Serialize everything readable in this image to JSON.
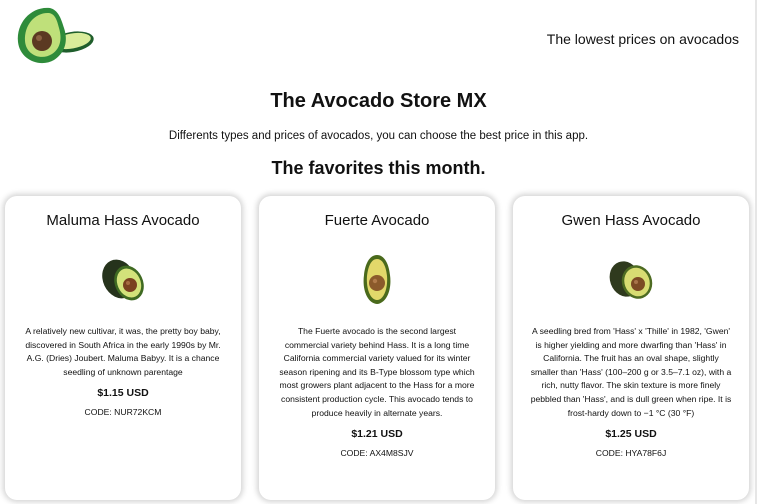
{
  "header": {
    "tagline": "The lowest prices on avocados"
  },
  "main": {
    "title": "The Avocado Store MX",
    "subtitle": "Differents types and prices of avocados, you can choose the best price in this app.",
    "section_title": "The favorites this month."
  },
  "products": [
    {
      "name": "Maluma Hass Avocado",
      "description": "A relatively new cultivar, it was, the pretty boy baby, discovered in South Africa in the early 1990s by Mr. A.G. (Dries) Joubert. Maluma Babyy. It is a chance seedling of unknown parentage",
      "price": "$1.15 USD",
      "code": "CODE: NUR72KCM",
      "image": "avocado-hass-icon"
    },
    {
      "name": "Fuerte Avocado",
      "description": "The Fuerte avocado is the second largest commercial variety behind Hass. It is a long time California commercial variety valued for its winter season ripening and its B-Type blossom type which most growers plant adjacent to the Hass for a more consistent production cycle. This avocado tends to produce heavily in alternate years.",
      "price": "$1.21 USD",
      "code": "CODE: AX4M8SJV",
      "image": "avocado-fuerte-icon"
    },
    {
      "name": "Gwen Hass Avocado",
      "description": "A seedling bred from 'Hass' x 'Thille' in 1982, 'Gwen' is higher yielding and more dwarfing than 'Hass' in California. The fruit has an oval shape, slightly smaller than 'Hass' (100–200 g or 3.5–7.1 oz), with a rich, nutty flavor. The skin texture is more finely pebbled than 'Hass', and is dull green when ripe. It is frost-hardy down to −1 °C (30 °F)",
      "price": "$1.25 USD",
      "code": "CODE: HYA78F6J",
      "image": "avocado-gwen-icon"
    }
  ],
  "colors": {
    "avocado_dark": "#2f5b2a",
    "avocado_light": "#a8d060",
    "pit": "#7a4a22"
  }
}
